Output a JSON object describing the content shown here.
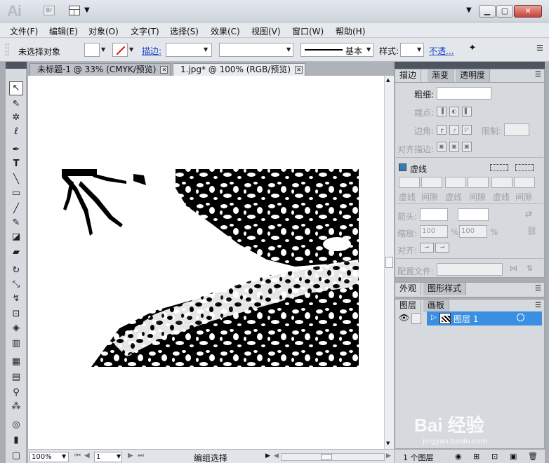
{
  "app": {
    "logo": "Ai",
    "bridge": "Br"
  },
  "menu": [
    "文件(F)",
    "编辑(E)",
    "对象(O)",
    "文字(T)",
    "选择(S)",
    "效果(C)",
    "视图(V)",
    "窗口(W)",
    "帮助(H)"
  ],
  "control_bar": {
    "selection_status": "未选择对象",
    "stroke_label": "描边:",
    "profile_label": "基本",
    "style_label": "样式:",
    "opacity_label": "不透..."
  },
  "tabs": [
    {
      "label": "未标题-1 @ 33% (CMYK/预览)",
      "active": false
    },
    {
      "label": "1.jpg* @ 100% (RGB/预览)",
      "active": true
    }
  ],
  "status_bar": {
    "zoom": "100%",
    "page": "1",
    "tool_status": "编组选择"
  },
  "stroke_panel": {
    "tabs": [
      "描边",
      "渐变",
      "透明度"
    ],
    "weight_label": "粗细:",
    "cap_label": "端点:",
    "corner_label": "边角:",
    "limit_label": "限制:",
    "align_label": "对齐描边:",
    "dashed_label": "虚线",
    "dash_fields": [
      "虚线",
      "间隙",
      "虚线",
      "间隙",
      "虚线",
      "间隙"
    ],
    "arrow_label": "箭头:",
    "scale_label": "缩放:",
    "scale_1": "100",
    "scale_2": "100",
    "scale_unit": "%",
    "align2_label": "对齐:",
    "profile_label": "配置文件:"
  },
  "appearance_panel": {
    "tabs": [
      "外观",
      "图形样式"
    ]
  },
  "layers_panel": {
    "tabs": [
      "图层",
      "画板"
    ],
    "layer_name": "图层 1",
    "count": "1 个图层"
  },
  "watermark": {
    "brand": "Bai 经验",
    "url": "jingyan.baidu.com"
  },
  "colors": {
    "selection": "#3a8fe2",
    "link": "#1a44c8",
    "close": "#c4443a"
  }
}
